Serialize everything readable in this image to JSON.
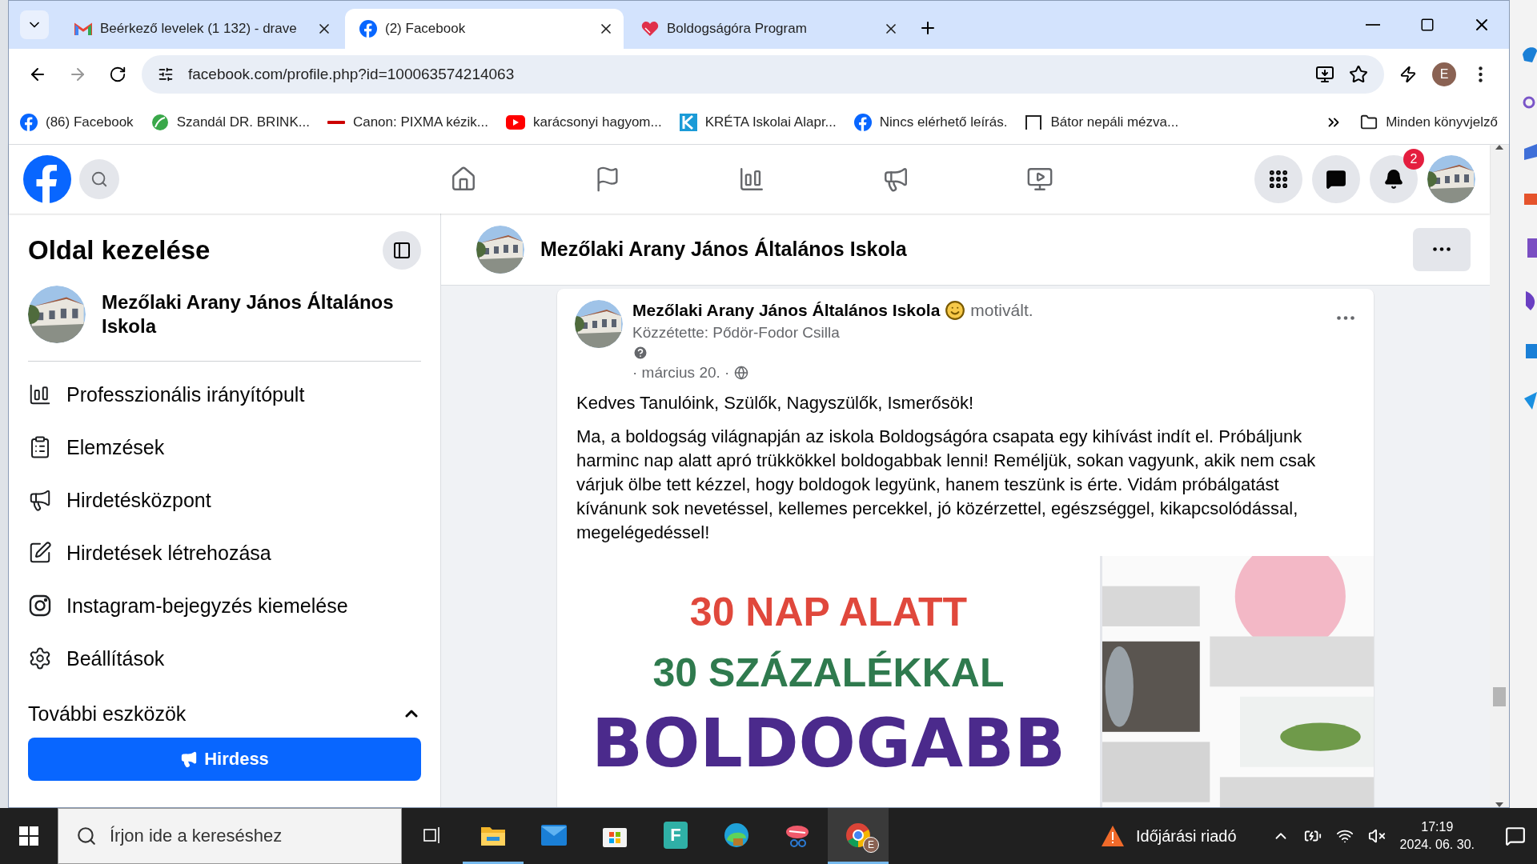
{
  "browser": {
    "tabs": [
      {
        "title": "Beérkező levelek (1 132) - drave",
        "kind": "gmail",
        "selected": false
      },
      {
        "title": "(2) Facebook",
        "kind": "facebook",
        "selected": true
      },
      {
        "title": "Boldogságóra Program",
        "kind": "heart",
        "selected": false
      }
    ],
    "url": "facebook.com/profile.php?id=100063574214063",
    "profile_initial": "E",
    "bookmarks": [
      {
        "label": "(86) Facebook",
        "kind": "facebook"
      },
      {
        "label": "Szandál DR. BRINK...",
        "kind": "leaf"
      },
      {
        "label": "Canon: PIXMA kézik...",
        "kind": "canon"
      },
      {
        "label": "karácsonyi hagyom...",
        "kind": "youtube"
      },
      {
        "label": "KRÉTA Iskolai Alapr...",
        "kind": "kreta"
      },
      {
        "label": "Nincs elérhető leírás.",
        "kind": "facebook"
      },
      {
        "label": "Bátor nepáli mézva...",
        "kind": "frame"
      }
    ],
    "all_bookmarks": "Minden könyvjelző"
  },
  "facebook": {
    "notification_count": "2",
    "sidebar": {
      "title": "Oldal kezelése",
      "page_name": "Mezőlaki Arany János Általános Iskola",
      "items": [
        {
          "label": "Professzionális irányítópult",
          "kind": "dashboard"
        },
        {
          "label": "Elemzések",
          "kind": "insights"
        },
        {
          "label": "Hirdetésközpont",
          "kind": "megaphone"
        },
        {
          "label": "Hirdetések létrehozása",
          "kind": "edit"
        },
        {
          "label": "Instagram-bejegyzés kiemelése",
          "kind": "instagram"
        },
        {
          "label": "Beállítások",
          "kind": "gear"
        }
      ],
      "more_tools": {
        "label": "További eszközök",
        "expanded": true
      },
      "promote_button": "Hirdess"
    },
    "page_header": {
      "name": "Mezőlaki Arany János Általános Iskola"
    },
    "post": {
      "author": "Mezőlaki Arany János Általános Iskola",
      "feeling": "motivált.",
      "posted_by": "Közzétette: Pődör-Fodor Csilla",
      "date": "· március 20. ·",
      "greeting": "Kedves Tanulóink, Szülők, Nagyszülők, Ismerősök!",
      "body": "Ma, a boldogság világnapján az iskola Boldogságóra csapata egy kihívást indít el. Próbáljunk harminc nap alatt apró trükkökkel boldogabbak lenni! Reméljük, sokan vagyunk, akik nem csak várjuk ölbe tett kézzel, hogy boldogok legyünk, hanem teszünk is érte. Vidám próbálgatást kívánunk sok nevetéssel, kellemes percekkel, jó közérzettel, egészséggel, kikapcsolódással, megelégedéssel!",
      "image_lines": [
        {
          "text": "30 NAP ALATT",
          "color": "#e0483c"
        },
        {
          "text": "30 SZÁZALÉKKAL",
          "color": "#2f7a4e"
        },
        {
          "text": "BOLDOGABB",
          "color": "#4b2a8c"
        }
      ]
    }
  },
  "taskbar": {
    "search_placeholder": "Írjon ide a kereséshez",
    "apps": [
      {
        "kind": "taskview",
        "running": false,
        "selected": false
      },
      {
        "kind": "explorer",
        "running": true,
        "selected": false
      },
      {
        "kind": "mail",
        "running": false,
        "selected": false
      },
      {
        "kind": "store",
        "running": false,
        "selected": false
      },
      {
        "kind": "letter",
        "label": "F",
        "running": false,
        "selected": false
      },
      {
        "kind": "edge",
        "running": false,
        "selected": false
      },
      {
        "kind": "snip",
        "running": false,
        "selected": false
      },
      {
        "kind": "chrome",
        "badge": "E",
        "running": true,
        "selected": true
      }
    ],
    "weather": "Időjárási riadó",
    "time": "17:19",
    "date": "2024. 06. 30."
  }
}
